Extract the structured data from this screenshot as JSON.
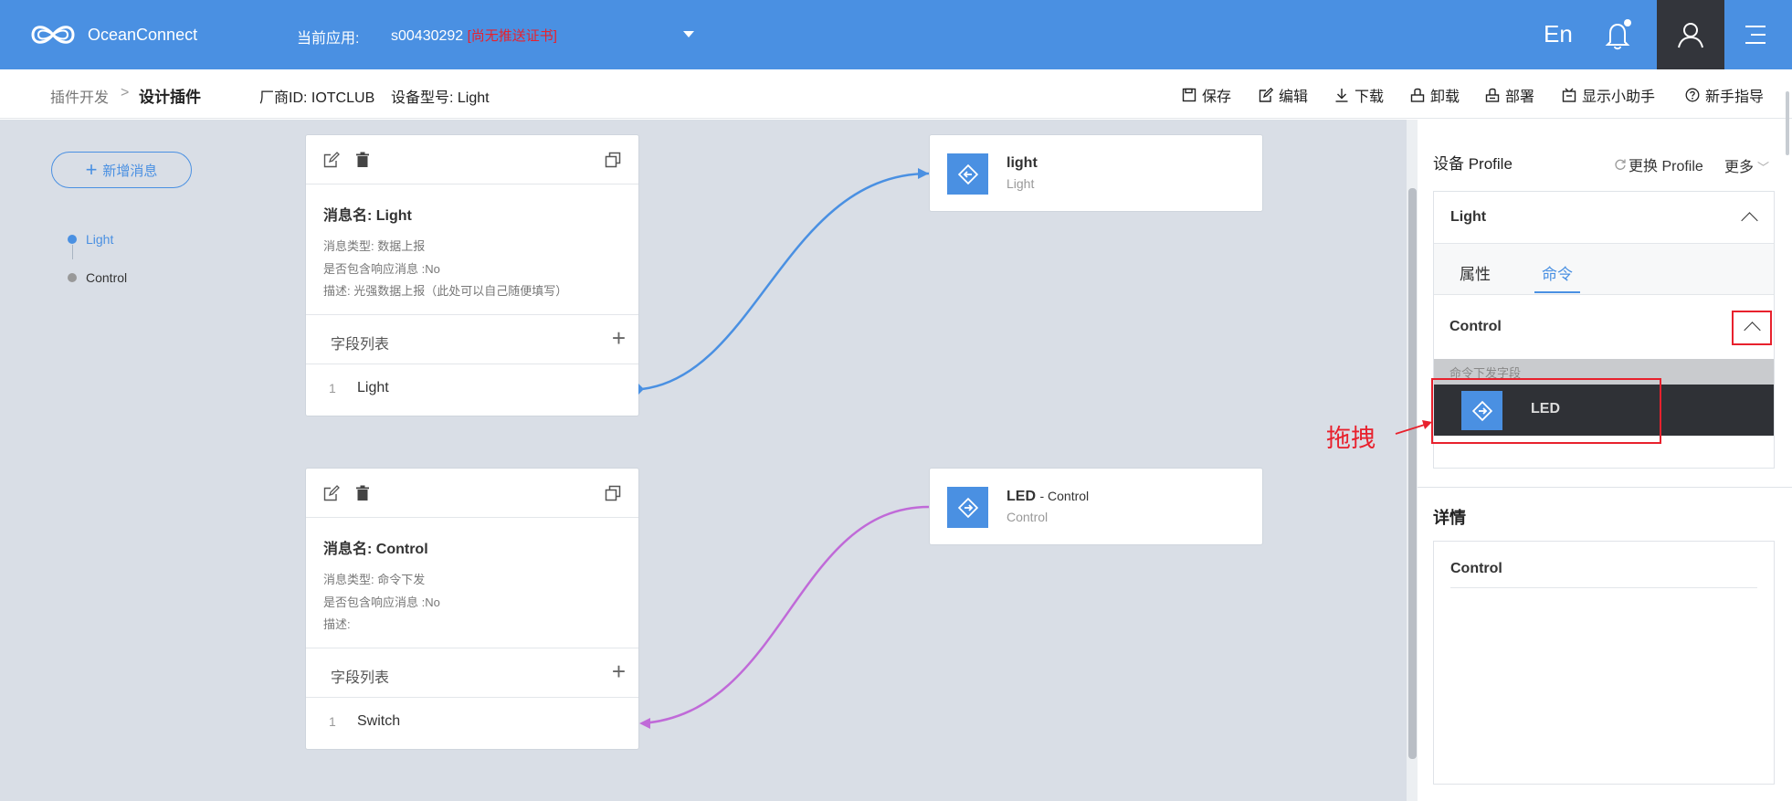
{
  "header": {
    "brand": "OceanConnect",
    "app_label": "当前应用:",
    "app_id": "s00430292",
    "app_warning": "[尚无推送证书]",
    "lang": "En"
  },
  "toolbar": {
    "breadcrumb_parent": "插件开发",
    "breadcrumb_sep": ">",
    "breadcrumb_current": "设计插件",
    "vendor": "厂商ID: IOTCLUB",
    "model": "设备型号: Light",
    "actions": [
      "保存",
      "编辑",
      "下载",
      "卸载",
      "部署",
      "显示小助手",
      "新手指导"
    ]
  },
  "sidebar": {
    "add_button": "新增消息",
    "messages": [
      {
        "label": "Light",
        "color": "#4a90e2"
      },
      {
        "label": "Control",
        "color": "#999999"
      }
    ]
  },
  "cards": [
    {
      "name": "消息名: Light",
      "type": "消息类型: 数据上报",
      "response": "是否包含响应消息 :No",
      "desc": "描述: 光强数据上报（此处可以自己随便填写）",
      "fields_title": "字段列表",
      "fields": [
        {
          "index": "1",
          "name": "Light"
        }
      ]
    },
    {
      "name": "消息名: Control",
      "type": "消息类型: 命令下发",
      "response": "是否包含响应消息 :No",
      "desc": "描述:",
      "fields_title": "字段列表",
      "fields": [
        {
          "index": "1",
          "name": "Switch"
        }
      ]
    }
  ],
  "property_cards": [
    {
      "title": "light",
      "subtitle": "Light",
      "title_suffix": ""
    },
    {
      "title": "LED",
      "title_suffix": "- Control",
      "subtitle": "Control"
    }
  ],
  "panel": {
    "title": "设备 Profile",
    "change": "更换 Profile",
    "more": "更多",
    "service": "Light",
    "tabs": [
      "属性",
      "命令"
    ],
    "active_tab": "命令",
    "command": "Control",
    "command_fields_label": "命令下发字段",
    "command_field": "LED",
    "detail_title": "详情",
    "detail_value": "Control"
  },
  "annotation": {
    "text": "拖拽",
    "color": "#e8212d"
  },
  "colors": {
    "primary": "#4a90e2",
    "light_wire": "#4a90e2",
    "control_wire": "#c06ad8",
    "canvas": "#d9dee6",
    "user_bg": "#33353b"
  }
}
